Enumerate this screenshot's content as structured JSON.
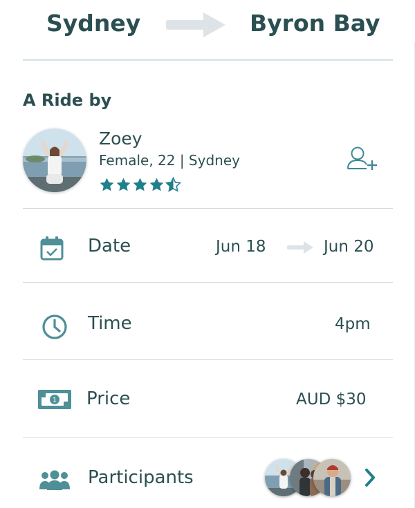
{
  "route": {
    "from": "Sydney",
    "to": "Byron Bay"
  },
  "ride": {
    "section_title": "A Ride by",
    "driver": {
      "name": "Zoey",
      "info": "Female, 22 | Sydney",
      "rating": 4.5,
      "rating_max": 5
    }
  },
  "details": {
    "date": {
      "label": "Date",
      "from": "Jun 18",
      "to": "Jun 20"
    },
    "time": {
      "label": "Time",
      "value": "4pm"
    },
    "price": {
      "label": "Price",
      "value": "AUD $30"
    },
    "participants": {
      "label": "Participants",
      "count_avatars": 3
    }
  },
  "colors": {
    "accent": "#3a8a96",
    "text": "#2b4f51",
    "arrow": "#dde3e6",
    "divider": "#d4d9db"
  },
  "icons": [
    "route-arrow-icon",
    "add-friend-icon",
    "calendar-check-icon",
    "clock-icon",
    "banknote-icon",
    "group-icon",
    "chevron-right-icon",
    "star-icon"
  ]
}
